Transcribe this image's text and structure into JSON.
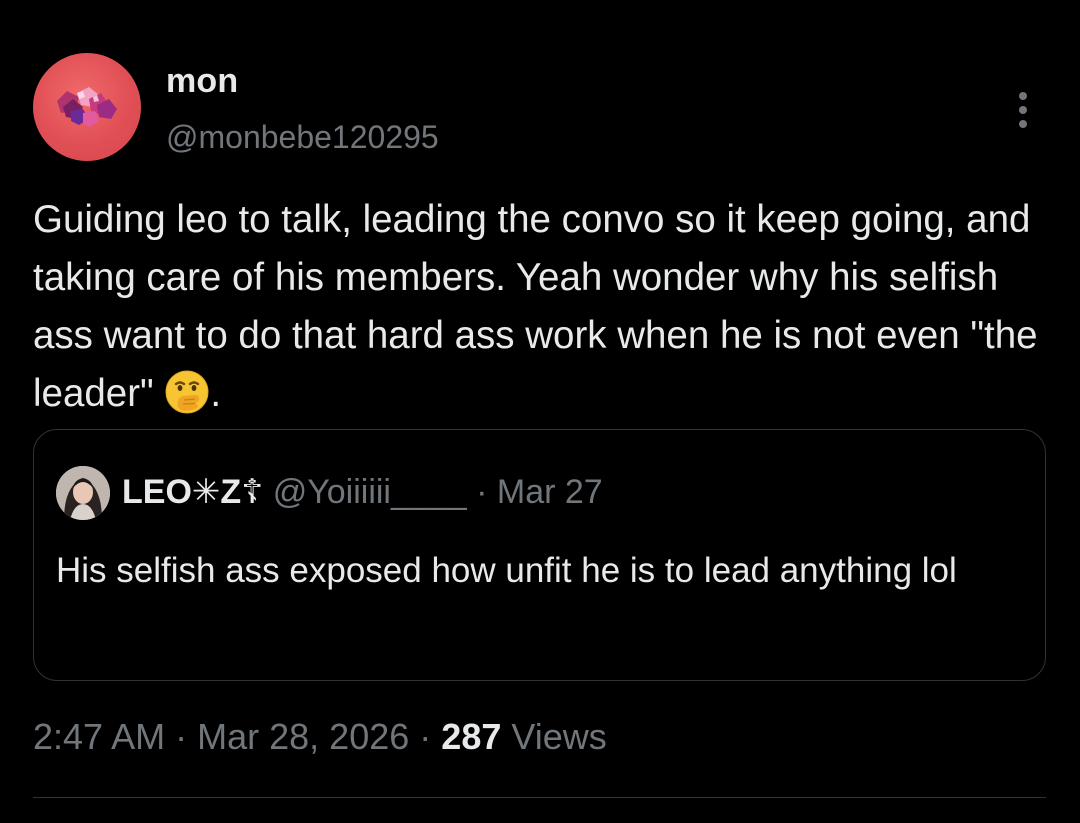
{
  "author": {
    "display_name": "mon",
    "handle": "@monbebe120295",
    "avatar_icon": "red-gems-avatar"
  },
  "more_menu_icon": "more-vertical-icon",
  "tweet": {
    "text": "Guiding leo to talk, leading the convo so it keep going, and taking care of his members. Yeah wonder why his selfish ass want to do that hard ass work when he is not even \"the leader\" ",
    "emoji": "face-with-hand-over-mouth",
    "text_end": "."
  },
  "quoted_tweet": {
    "display_name": "LEO✳Z☦",
    "handle": "@Yoiiiiii____",
    "separator": "·",
    "date": "Mar 27",
    "text": "His selfish ass exposed how unfit he is to lead anything lol"
  },
  "meta": {
    "time": "2:47 AM",
    "separator": "·",
    "date": "Mar 28, 2026",
    "views_count": "287",
    "views_label": "Views"
  },
  "colors": {
    "background": "#000000",
    "text_primary": "#e7e9ea",
    "text_secondary": "#71767b",
    "border": "#2f3336",
    "avatar_bg": "#e04f55"
  }
}
